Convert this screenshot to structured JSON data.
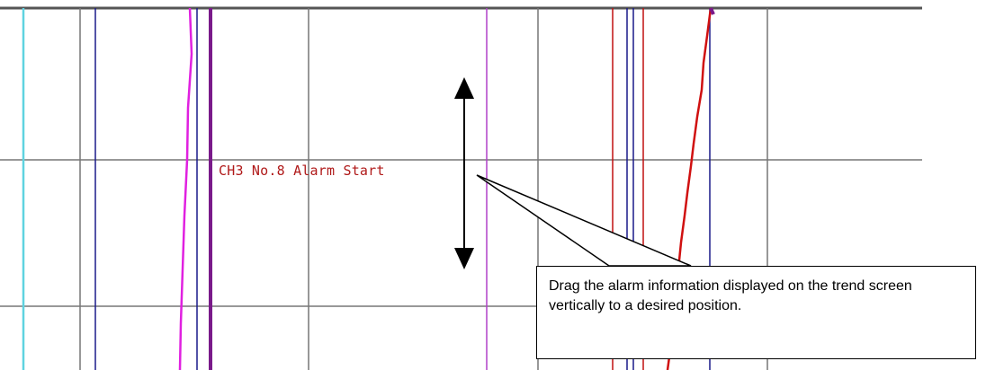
{
  "trend": {
    "alarm_label": "CH3 No.8 Alarm Start"
  },
  "callout": {
    "text": "Drag the alarm information displayed on the trend screen vertically to a desired position."
  },
  "colors": {
    "grid": "#777777",
    "cyan_trace": "#5fd3e0",
    "magenta_trace": "#e020e0",
    "purple_trace": "#7a1a8a",
    "navy_trace": "#1a1a8a",
    "red_trace": "#c01010",
    "alarm_text": "#b01a1a",
    "drag_arrow": "#000000"
  },
  "icons": {
    "drag_arrow": "double-headed-vertical-arrow"
  }
}
